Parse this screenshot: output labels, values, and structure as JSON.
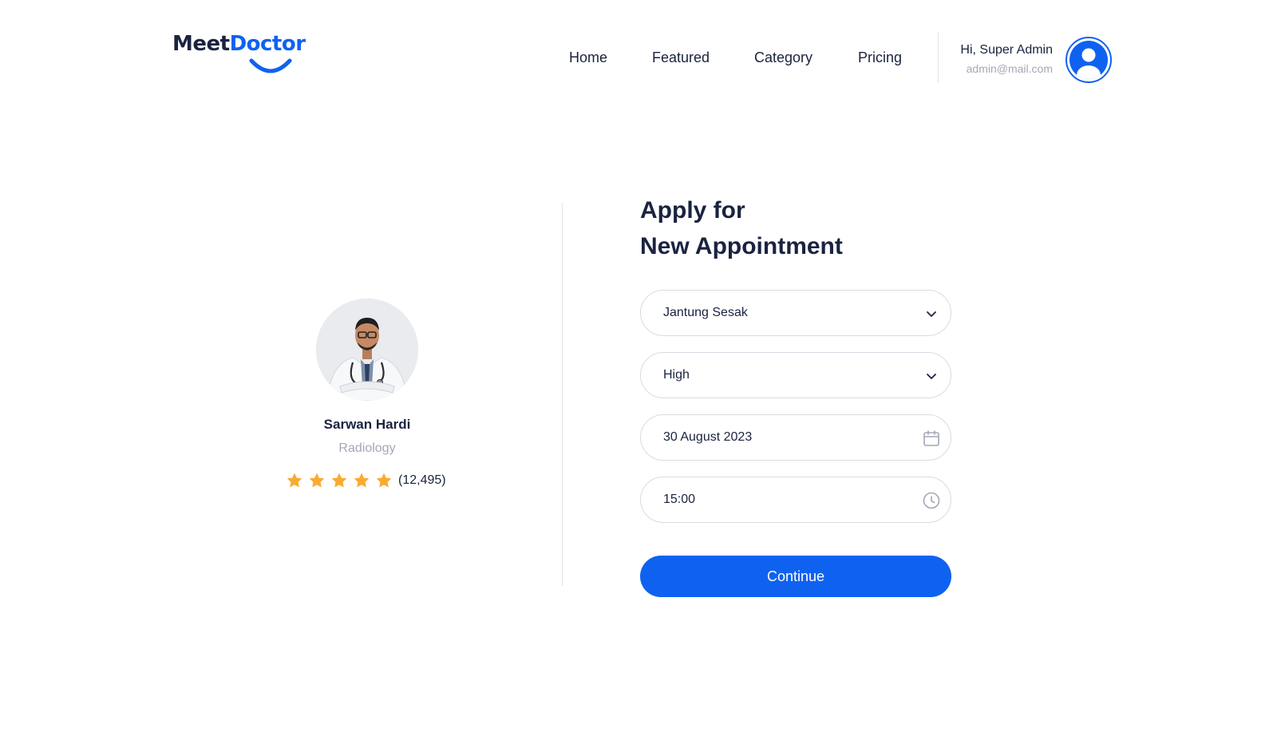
{
  "brand": {
    "meet": "Meet",
    "doctor": "Doctor",
    "accent": "#0f62f0",
    "dark": "#1a2340"
  },
  "nav": {
    "items": [
      "Home",
      "Featured",
      "Category",
      "Pricing"
    ]
  },
  "user": {
    "greeting": "Hi, Super Admin",
    "email": "admin@mail.com",
    "avatar_icon": "user-circle-icon"
  },
  "doctor": {
    "name": "Sarwan Hardi",
    "specialty": "Radiology",
    "rating_stars": 5,
    "reviews": "(12,495)"
  },
  "form": {
    "title_line1": "Apply for",
    "title_line2": "New Appointment",
    "complaint": {
      "value": "Jantung Sesak",
      "icon": "chevron-down-icon"
    },
    "level": {
      "value": "High",
      "icon": "chevron-down-icon"
    },
    "date": {
      "value": "30 August 2023",
      "icon": "calendar-icon"
    },
    "time": {
      "value": "15:00",
      "icon": "clock-icon"
    },
    "submit": "Continue"
  }
}
